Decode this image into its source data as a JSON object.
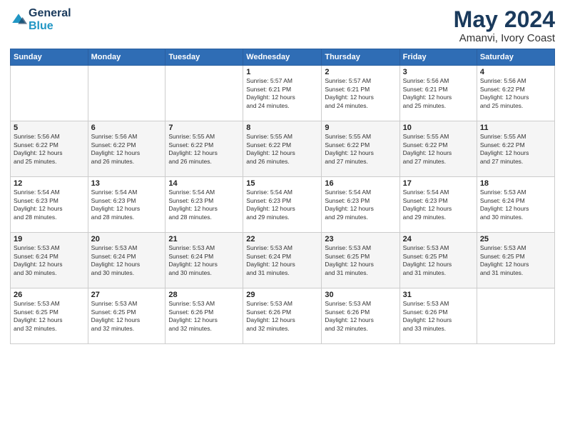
{
  "header": {
    "logo_line1": "General",
    "logo_line2": "Blue",
    "month_title": "May 2024",
    "location": "Amanvi, Ivory Coast"
  },
  "weekdays": [
    "Sunday",
    "Monday",
    "Tuesday",
    "Wednesday",
    "Thursday",
    "Friday",
    "Saturday"
  ],
  "weeks": [
    [
      {
        "day": "",
        "info": ""
      },
      {
        "day": "",
        "info": ""
      },
      {
        "day": "",
        "info": ""
      },
      {
        "day": "1",
        "info": "Sunrise: 5:57 AM\nSunset: 6:21 PM\nDaylight: 12 hours\nand 24 minutes."
      },
      {
        "day": "2",
        "info": "Sunrise: 5:57 AM\nSunset: 6:21 PM\nDaylight: 12 hours\nand 24 minutes."
      },
      {
        "day": "3",
        "info": "Sunrise: 5:56 AM\nSunset: 6:21 PM\nDaylight: 12 hours\nand 25 minutes."
      },
      {
        "day": "4",
        "info": "Sunrise: 5:56 AM\nSunset: 6:22 PM\nDaylight: 12 hours\nand 25 minutes."
      }
    ],
    [
      {
        "day": "5",
        "info": "Sunrise: 5:56 AM\nSunset: 6:22 PM\nDaylight: 12 hours\nand 25 minutes."
      },
      {
        "day": "6",
        "info": "Sunrise: 5:56 AM\nSunset: 6:22 PM\nDaylight: 12 hours\nand 26 minutes."
      },
      {
        "day": "7",
        "info": "Sunrise: 5:55 AM\nSunset: 6:22 PM\nDaylight: 12 hours\nand 26 minutes."
      },
      {
        "day": "8",
        "info": "Sunrise: 5:55 AM\nSunset: 6:22 PM\nDaylight: 12 hours\nand 26 minutes."
      },
      {
        "day": "9",
        "info": "Sunrise: 5:55 AM\nSunset: 6:22 PM\nDaylight: 12 hours\nand 27 minutes."
      },
      {
        "day": "10",
        "info": "Sunrise: 5:55 AM\nSunset: 6:22 PM\nDaylight: 12 hours\nand 27 minutes."
      },
      {
        "day": "11",
        "info": "Sunrise: 5:55 AM\nSunset: 6:22 PM\nDaylight: 12 hours\nand 27 minutes."
      }
    ],
    [
      {
        "day": "12",
        "info": "Sunrise: 5:54 AM\nSunset: 6:23 PM\nDaylight: 12 hours\nand 28 minutes."
      },
      {
        "day": "13",
        "info": "Sunrise: 5:54 AM\nSunset: 6:23 PM\nDaylight: 12 hours\nand 28 minutes."
      },
      {
        "day": "14",
        "info": "Sunrise: 5:54 AM\nSunset: 6:23 PM\nDaylight: 12 hours\nand 28 minutes."
      },
      {
        "day": "15",
        "info": "Sunrise: 5:54 AM\nSunset: 6:23 PM\nDaylight: 12 hours\nand 29 minutes."
      },
      {
        "day": "16",
        "info": "Sunrise: 5:54 AM\nSunset: 6:23 PM\nDaylight: 12 hours\nand 29 minutes."
      },
      {
        "day": "17",
        "info": "Sunrise: 5:54 AM\nSunset: 6:23 PM\nDaylight: 12 hours\nand 29 minutes."
      },
      {
        "day": "18",
        "info": "Sunrise: 5:53 AM\nSunset: 6:24 PM\nDaylight: 12 hours\nand 30 minutes."
      }
    ],
    [
      {
        "day": "19",
        "info": "Sunrise: 5:53 AM\nSunset: 6:24 PM\nDaylight: 12 hours\nand 30 minutes."
      },
      {
        "day": "20",
        "info": "Sunrise: 5:53 AM\nSunset: 6:24 PM\nDaylight: 12 hours\nand 30 minutes."
      },
      {
        "day": "21",
        "info": "Sunrise: 5:53 AM\nSunset: 6:24 PM\nDaylight: 12 hours\nand 30 minutes."
      },
      {
        "day": "22",
        "info": "Sunrise: 5:53 AM\nSunset: 6:24 PM\nDaylight: 12 hours\nand 31 minutes."
      },
      {
        "day": "23",
        "info": "Sunrise: 5:53 AM\nSunset: 6:25 PM\nDaylight: 12 hours\nand 31 minutes."
      },
      {
        "day": "24",
        "info": "Sunrise: 5:53 AM\nSunset: 6:25 PM\nDaylight: 12 hours\nand 31 minutes."
      },
      {
        "day": "25",
        "info": "Sunrise: 5:53 AM\nSunset: 6:25 PM\nDaylight: 12 hours\nand 31 minutes."
      }
    ],
    [
      {
        "day": "26",
        "info": "Sunrise: 5:53 AM\nSunset: 6:25 PM\nDaylight: 12 hours\nand 32 minutes."
      },
      {
        "day": "27",
        "info": "Sunrise: 5:53 AM\nSunset: 6:25 PM\nDaylight: 12 hours\nand 32 minutes."
      },
      {
        "day": "28",
        "info": "Sunrise: 5:53 AM\nSunset: 6:26 PM\nDaylight: 12 hours\nand 32 minutes."
      },
      {
        "day": "29",
        "info": "Sunrise: 5:53 AM\nSunset: 6:26 PM\nDaylight: 12 hours\nand 32 minutes."
      },
      {
        "day": "30",
        "info": "Sunrise: 5:53 AM\nSunset: 6:26 PM\nDaylight: 12 hours\nand 32 minutes."
      },
      {
        "day": "31",
        "info": "Sunrise: 5:53 AM\nSunset: 6:26 PM\nDaylight: 12 hours\nand 33 minutes."
      },
      {
        "day": "",
        "info": ""
      }
    ]
  ]
}
